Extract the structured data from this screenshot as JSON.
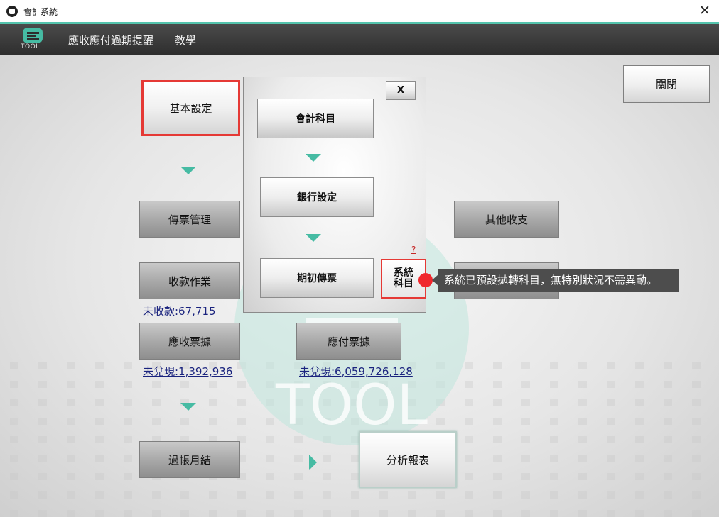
{
  "window": {
    "title": "會計系統",
    "close_glyph": "✕"
  },
  "appbar": {
    "logo_text": "TOOL",
    "menu": [
      {
        "label": "應收應付過期提醒"
      },
      {
        "label": "教學"
      }
    ]
  },
  "main": {
    "close_label": "關閉",
    "basic_settings_label": "基本設定",
    "voucher_mgmt_label": "傳票管理",
    "receipts_label": "收款作業",
    "receipts_outstanding": "未收款:67,715",
    "notes_receivable_label": "應收票據",
    "notes_receivable_uncashed": "未兌現:1,392,936",
    "notes_payable_label": "應付票據",
    "notes_payable_uncashed": "未兌現:6,059,726,128",
    "other_income_label": "其他收支",
    "posting_label": "過帳月結",
    "analysis_label": "分析報表"
  },
  "popup": {
    "close_label": "X",
    "accounts_label": "會計科目",
    "bank_settings_label": "銀行設定",
    "opening_voucher_label": "期初傳票",
    "help_label": "?",
    "system_accounts_line1": "系統",
    "system_accounts_line2": "科目"
  },
  "tooltip": {
    "text": "系統已預設拋轉科目，無特別狀況不需異動。"
  },
  "colors": {
    "accent": "#46bba3",
    "highlight": "#e53935",
    "appbar": "#3a3a3a",
    "link": "#1a237e"
  },
  "icons": [
    "app-icon",
    "close-icon",
    "etool-logo-icon",
    "arrow-down-icon",
    "arrow-right-icon",
    "status-dot-icon"
  ]
}
